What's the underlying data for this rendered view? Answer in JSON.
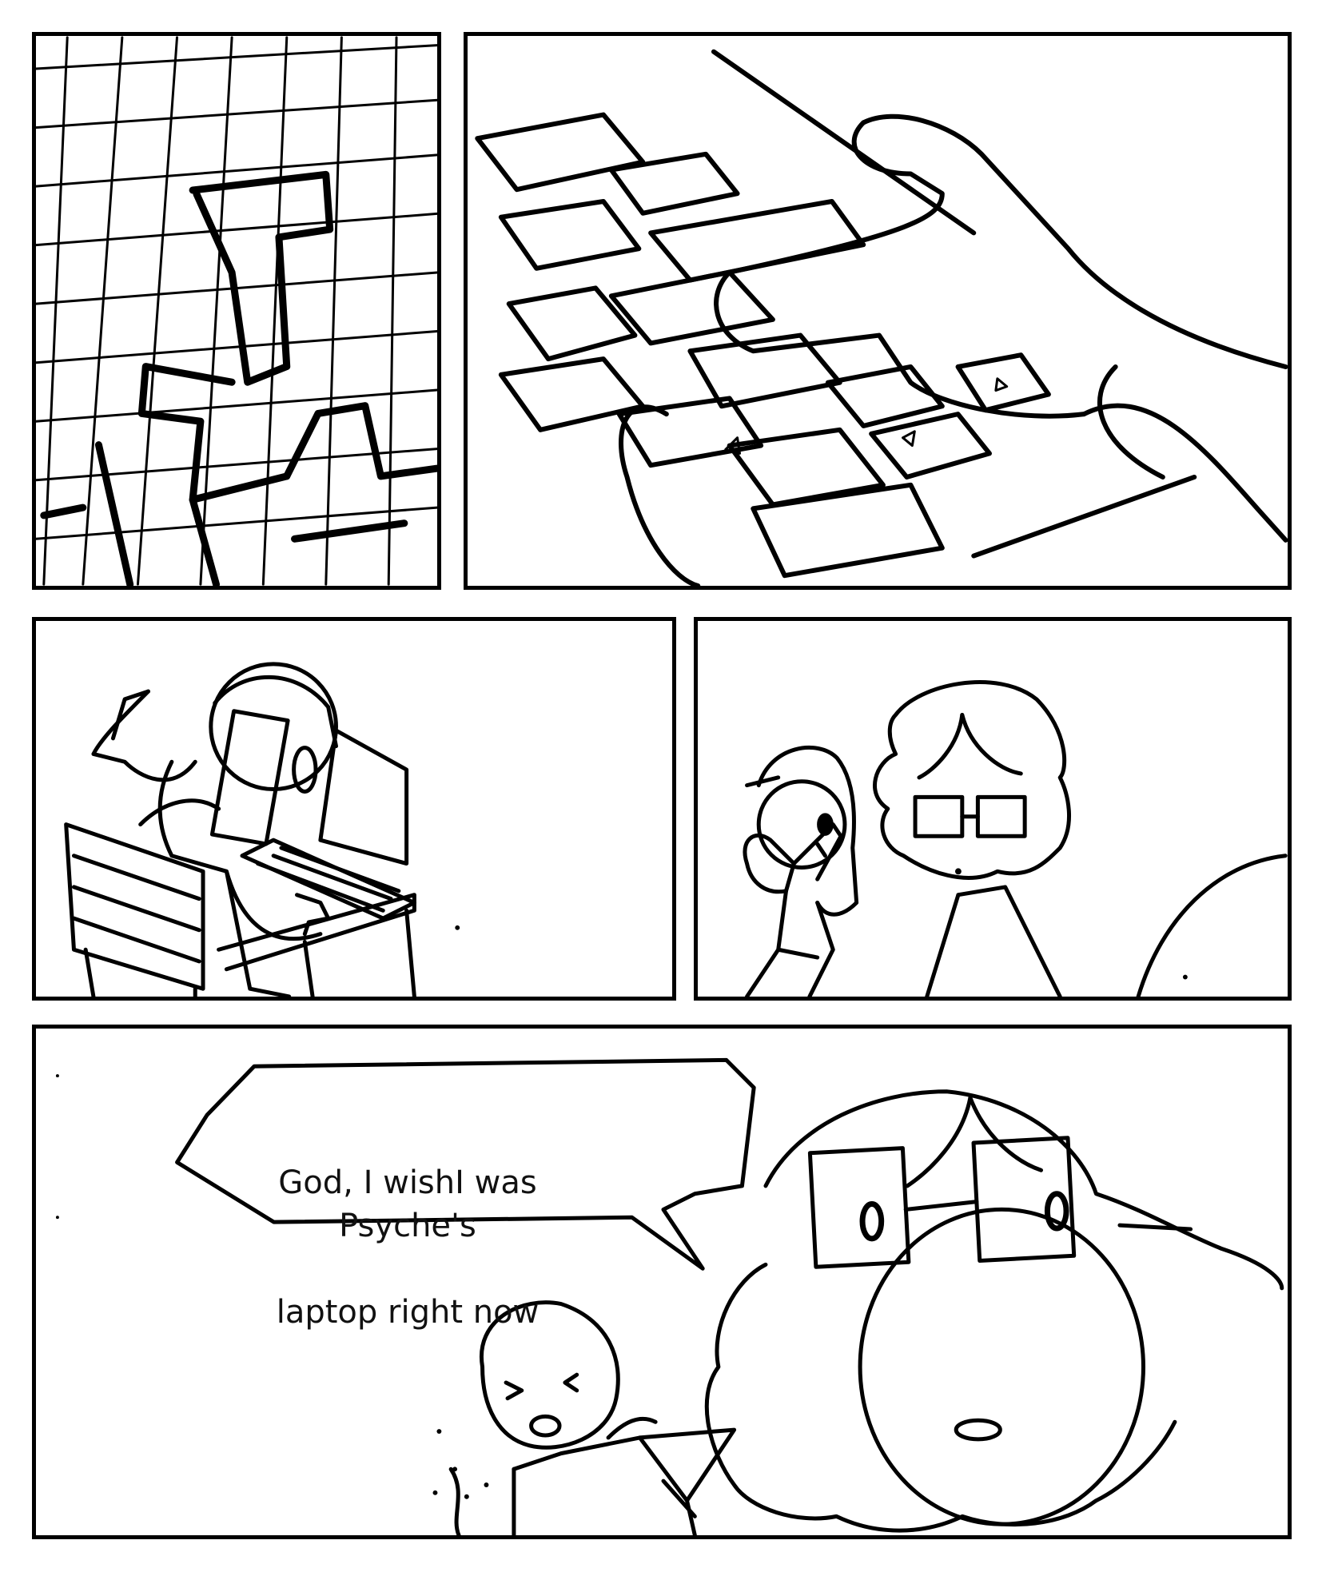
{
  "colors": {
    "ink": "#000000",
    "paper": "#ffffff"
  },
  "panels": [
    {
      "name": "grid-closeup",
      "icons": [
        "grid-pattern-icon"
      ]
    },
    {
      "name": "keyboard-hand",
      "icons": [
        "keyboard-icon",
        "hand-icon",
        "arrow-key-icon"
      ]
    },
    {
      "name": "person-at-laptop",
      "icons": [
        "person-icon",
        "laptop-icon"
      ]
    },
    {
      "name": "two-onlookers",
      "icons": [
        "person-icon",
        "glasses-icon"
      ]
    },
    {
      "name": "speech-scene",
      "icons": [
        "person-icon",
        "glasses-icon",
        "speech-bubble-icon"
      ]
    }
  ],
  "speech": {
    "line1": "God, I wishI was Psyche's",
    "line2": "laptop right now"
  }
}
